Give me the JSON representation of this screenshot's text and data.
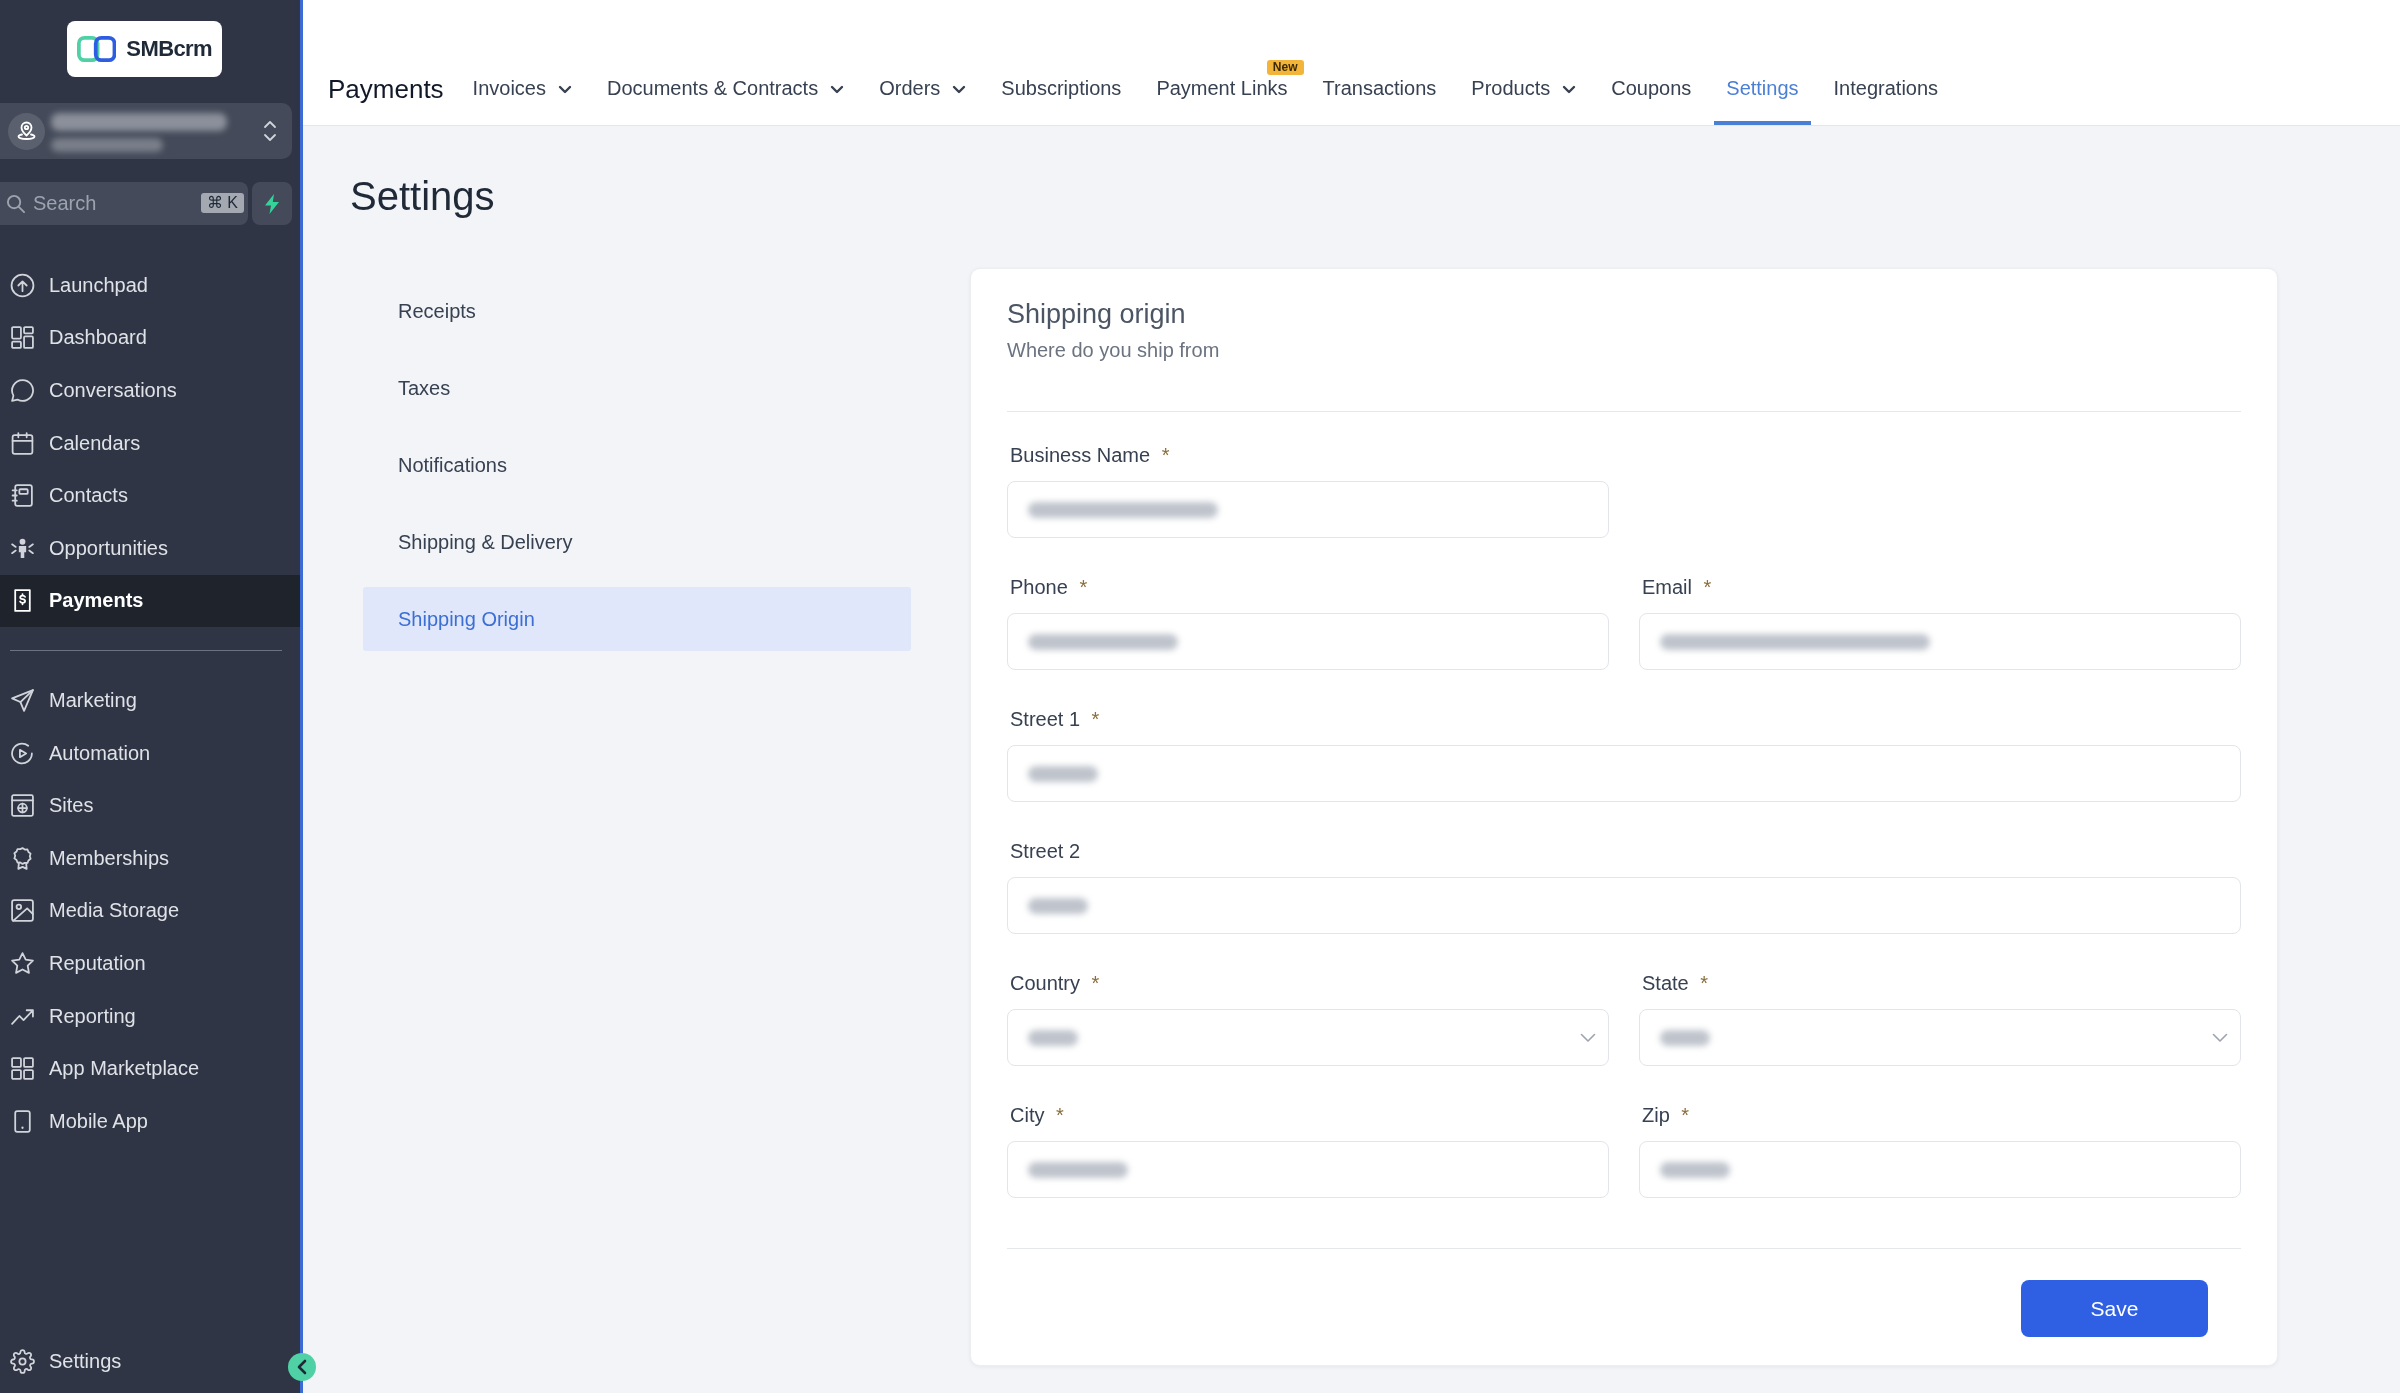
{
  "sidebar": {
    "logo": {
      "text": "SMBcrm"
    },
    "account": {
      "redacted": true
    },
    "search": {
      "placeholder": "Search",
      "shortcut": "⌘ K"
    },
    "sections": [
      {
        "items": [
          {
            "label": "Launchpad",
            "selected": false
          },
          {
            "label": "Dashboard",
            "selected": false
          },
          {
            "label": "Conversations",
            "selected": false
          },
          {
            "label": "Calendars",
            "selected": false
          },
          {
            "label": "Contacts",
            "selected": false
          },
          {
            "label": "Opportunities",
            "selected": false
          },
          {
            "label": "Payments",
            "selected": true
          }
        ]
      },
      {
        "items": [
          {
            "label": "Marketing",
            "selected": false
          },
          {
            "label": "Automation",
            "selected": false
          },
          {
            "label": "Sites",
            "selected": false
          },
          {
            "label": "Memberships",
            "selected": false
          },
          {
            "label": "Media Storage",
            "selected": false
          },
          {
            "label": "Reputation",
            "selected": false
          },
          {
            "label": "Reporting",
            "selected": false
          },
          {
            "label": "App Marketplace",
            "selected": false
          },
          {
            "label": "Mobile App",
            "selected": false
          }
        ]
      }
    ],
    "footer_items": [
      {
        "label": "Settings",
        "selected": false
      }
    ]
  },
  "header": {
    "title": "Payments",
    "tabs": [
      {
        "label": "Invoices",
        "dropdown": true,
        "selected": false
      },
      {
        "label": "Documents & Contracts",
        "dropdown": true,
        "selected": false
      },
      {
        "label": "Orders",
        "dropdown": true,
        "selected": false
      },
      {
        "label": "Subscriptions",
        "dropdown": false,
        "selected": false
      },
      {
        "label": "Payment Links",
        "dropdown": false,
        "selected": false,
        "badge": "New"
      },
      {
        "label": "Transactions",
        "dropdown": false,
        "selected": false
      },
      {
        "label": "Products",
        "dropdown": true,
        "selected": false
      },
      {
        "label": "Coupons",
        "dropdown": false,
        "selected": false
      },
      {
        "label": "Settings",
        "dropdown": false,
        "selected": true
      },
      {
        "label": "Integrations",
        "dropdown": false,
        "selected": false
      }
    ]
  },
  "page": {
    "title": "Settings",
    "menu": [
      {
        "label": "Receipts",
        "selected": false
      },
      {
        "label": "Taxes",
        "selected": false
      },
      {
        "label": "Notifications",
        "selected": false
      },
      {
        "label": "Shipping & Delivery",
        "selected": false
      },
      {
        "label": "Shipping Origin",
        "selected": true
      }
    ],
    "card": {
      "title": "Shipping origin",
      "subtitle": "Where do you ship from",
      "rows": [
        {
          "fields": [
            {
              "label": "Business Name",
              "required_mark": "*",
              "kind": "text",
              "wide": false,
              "redacted": true
            }
          ]
        },
        {
          "fields": [
            {
              "label": "Phone",
              "required_mark": "*",
              "kind": "text",
              "wide": false,
              "redacted": true
            },
            {
              "label": "Email",
              "required_mark": "*",
              "kind": "text",
              "wide": false,
              "redacted": true
            }
          ]
        },
        {
          "fields": [
            {
              "label": "Street 1",
              "required_mark": "*",
              "kind": "text",
              "wide": true,
              "redacted": true
            }
          ]
        },
        {
          "fields": [
            {
              "label": "Street 2",
              "kind": "text",
              "wide": true,
              "redacted": true
            }
          ]
        },
        {
          "fields": [
            {
              "label": "Country",
              "required_mark": "*",
              "kind": "select",
              "wide": false,
              "redacted": true
            },
            {
              "label": "State",
              "required_mark": "*",
              "kind": "select",
              "wide": false,
              "redacted": true
            }
          ]
        },
        {
          "fields": [
            {
              "label": "City",
              "required_mark": "*",
              "kind": "text",
              "wide": false,
              "redacted": true
            },
            {
              "label": "Zip",
              "required_mark": "*",
              "kind": "text",
              "wide": false,
              "redacted": true
            }
          ]
        }
      ],
      "save_button": "Save"
    }
  }
}
